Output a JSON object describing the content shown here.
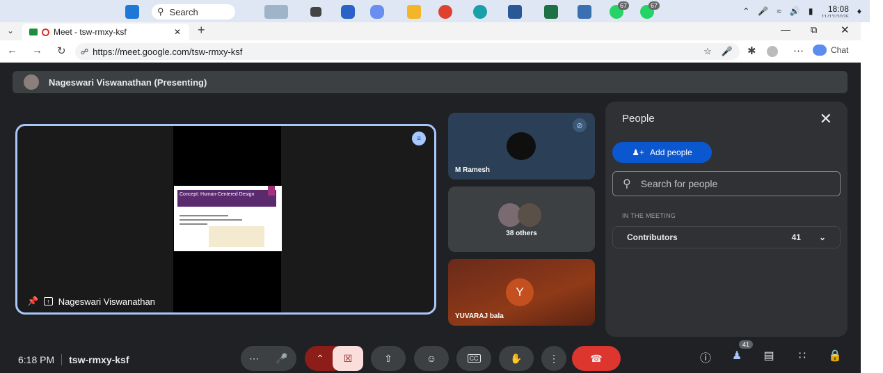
{
  "taskbar": {
    "search_label": "Search",
    "badge1": "67",
    "badge2": "67",
    "clock": "18:08",
    "date": "11/12/2025"
  },
  "browser": {
    "tab_title": "Meet - tsw-rmxy-ksf",
    "url": "https://meet.google.com/tsw-rmxy-ksf",
    "chat_label": "Chat"
  },
  "meet": {
    "presenting_label": "Nageswari Viswanathan (Presenting)",
    "main_tile_name": "Nageswari Viswanathan",
    "slide_title": "Concept: Human-Centered Design",
    "tiles": {
      "tile1_name": "M Ramesh",
      "tile2_label": "38 others",
      "tile3_initial": "Y",
      "tile3_name": "YUVARAJ bala"
    },
    "people_panel": {
      "title": "People",
      "add_people": "Add people",
      "search_placeholder": "Search for people",
      "section": "IN THE MEETING",
      "group_label": "Contributors",
      "group_count": "41"
    },
    "bottom": {
      "time": "6:18 PM",
      "meeting_code": "tsw-rmxy-ksf",
      "people_count": "41"
    }
  }
}
